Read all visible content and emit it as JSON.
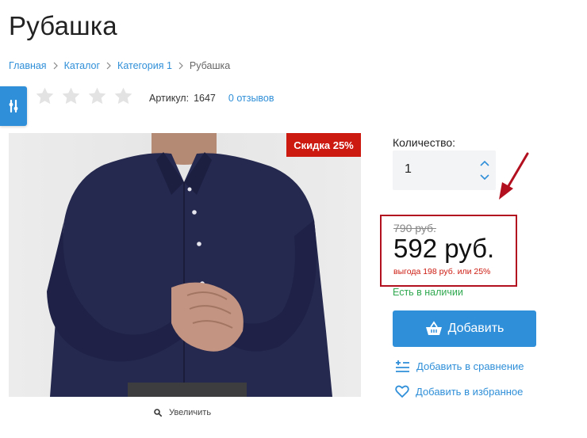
{
  "page": {
    "title": "Рубашка"
  },
  "breadcrumb": [
    {
      "label": "Главная"
    },
    {
      "label": "Каталог"
    },
    {
      "label": "Категория 1"
    },
    {
      "label": "Рубашка"
    }
  ],
  "rating": {
    "filled": 0,
    "total": 5
  },
  "meta": {
    "article_label": "Артикул:",
    "article_value": "1647",
    "reviews_label": "0 отзывов"
  },
  "badge": {
    "discount_label": "Скидка 25%"
  },
  "image": {
    "zoom_label": "Увеличить"
  },
  "quantity": {
    "label": "Количество:",
    "value": "1"
  },
  "price": {
    "old": "790 руб.",
    "new": "592 руб.",
    "saving": "выгода 198 руб. или 25%"
  },
  "stock": {
    "label": "Есть в наличии"
  },
  "actions": {
    "add_label": "Добавить",
    "compare_label": "Добавить в сравнение",
    "favorite_label": "Добавить в избранное"
  },
  "icons": {
    "sort": "sort-icon",
    "star": "star-icon",
    "chevron": "chevron-right-icon",
    "search": "search-icon",
    "basket": "basket-icon",
    "compare": "compare-icon",
    "heart": "heart-icon",
    "arrow": "arrow-icon",
    "up": "chevron-up-icon",
    "down": "chevron-down-icon"
  },
  "colors": {
    "accent": "#2f8fd8",
    "badge": "#cc1a10",
    "highlight_border": "#b3101f",
    "stock": "#2fa84f",
    "star_empty": "#e3e3e3"
  }
}
